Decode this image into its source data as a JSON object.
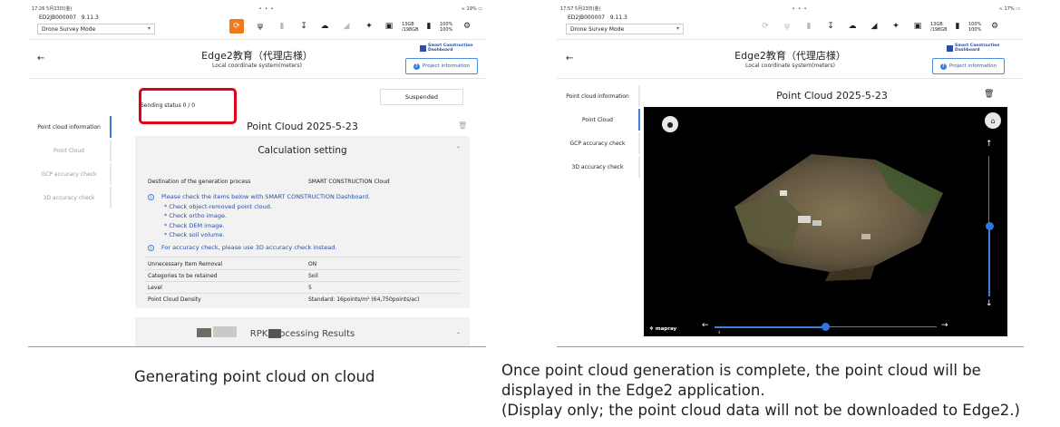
{
  "left_screen": {
    "status_time": "17:26",
    "status_date": "5月23日(金)",
    "status_dots": "• • •",
    "status_right": "19%",
    "device_id": "ED2JB000007",
    "version": "9.11.3",
    "mode": "Drone Survey Mode",
    "storage": {
      "free": "13GB",
      "total": "/198GB"
    },
    "battery": {
      "a": "100%",
      "b": "100%"
    },
    "project_title": "Edge2教育（代理店様）",
    "coord_system": "Local coordinate system(meters)",
    "scd_logo": [
      "Smart Construction",
      "Dashboard"
    ],
    "project_button": "Project information",
    "nav": [
      {
        "label": "Point cloud information"
      },
      {
        "label": "Point Cloud"
      },
      {
        "label": "GCP accuracy check"
      },
      {
        "label": "3D accuracy check"
      }
    ],
    "sending_status": "Sending status 0 / 0",
    "suspended_label": "Suspended",
    "point_cloud_title": "Point Cloud 2025-5-23",
    "calc_title": "Calculation setting",
    "destination_label": "Destination of the generation process",
    "destination_value": "SMART CONSTRUCTION Cloud",
    "notes": [
      "Please check the items below with SMART CONSTRUCTION Dashboard.",
      "* Check object-removed point cloud.",
      "* Check ortho image.",
      "* Check DEM image.",
      "* Check soil volume."
    ],
    "accuracy_note": "For accuracy check, please use 3D accuracy check instead.",
    "settings": [
      {
        "label": "Unnecessary Item Removal",
        "value": "ON"
      },
      {
        "label": "Categories to be retained",
        "value": "Soil"
      },
      {
        "label": "Level",
        "value": "5"
      },
      {
        "label": "Point Cloud Density",
        "value": "Standard: 16points/m² (64,750points/ac)"
      }
    ],
    "rpk_title": "RPK Processing Results"
  },
  "right_screen": {
    "status_time": "17:57",
    "status_date": "5月23日(金)",
    "status_dots": "• • •",
    "status_right": "17%",
    "device_id": "ED2JB000007",
    "version": "9.11.3",
    "mode": "Drone Survey Mode",
    "storage": {
      "free": "13GB",
      "total": "/198GB"
    },
    "battery": {
      "a": "100%",
      "b": "100%"
    },
    "project_title": "Edge2教育（代理店様）",
    "coord_system": "Local coordinate system(meters)",
    "scd_logo": [
      "Smart Construction",
      "Dashboard"
    ],
    "project_button": "Project information",
    "nav": [
      {
        "label": "Point cloud information"
      },
      {
        "label": "Point Cloud"
      },
      {
        "label": "GCP accuracy check"
      },
      {
        "label": "3D accuracy check"
      }
    ],
    "point_cloud_title": "Point Cloud 2025-5-23",
    "viewer_logo": "mapray",
    "viewer_scale": "4",
    "timeline_position": 0.5,
    "vertical_slider_position": 0.5
  },
  "captions": {
    "left": "Generating point cloud on cloud",
    "right_line1": "Once point cloud generation is complete, the point cloud will be",
    "right_line2": "displayed in the Edge2 application.",
    "right_line3": "(Display only; the point cloud data will not be downloaded to Edge2.)"
  },
  "colors": {
    "accent": "#3b7fd8",
    "highlight": "#e0001a",
    "active_tool": "#f07a1a"
  }
}
